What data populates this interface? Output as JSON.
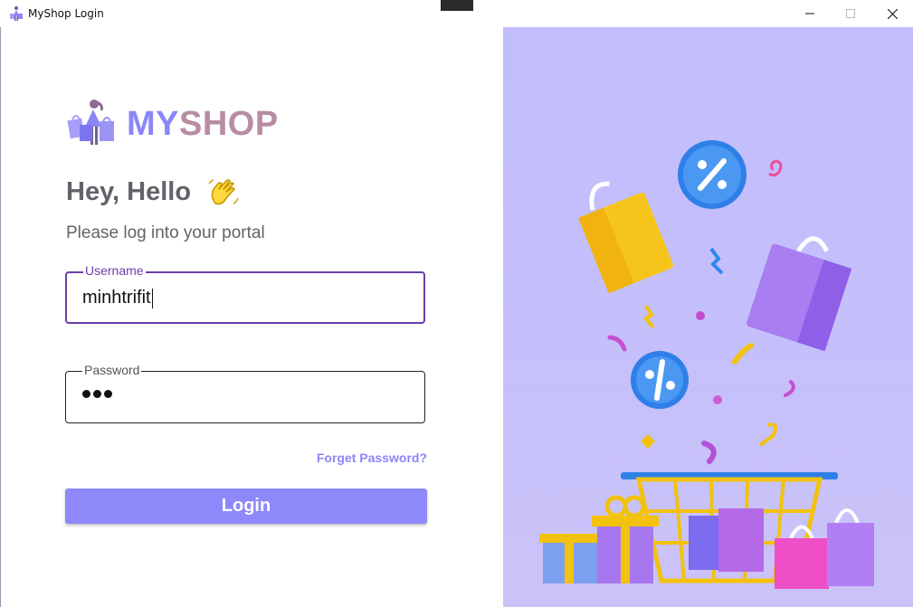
{
  "window": {
    "title": "MyShop Login",
    "minimize_label": "—",
    "maximize_label": "☐",
    "close_label": "✕"
  },
  "brand": {
    "name_part1": "MY",
    "name_part2": "SHOP"
  },
  "greeting": {
    "title": "Hey, Hello",
    "subtitle": "Please log into your portal"
  },
  "form": {
    "username": {
      "label": "Username",
      "value": "minhtrifit"
    },
    "password": {
      "label": "Password",
      "masked_length": 3
    },
    "forget_label": "Forget Password?",
    "login_label": "Login"
  },
  "colors": {
    "accent": "#8b86f8",
    "button": "#8e89fb",
    "focus_border": "#6b3fa8",
    "text": "#616369",
    "illustration_bg": "#c2bdfd"
  },
  "icons": {
    "app": "shopping-girl-icon",
    "wave": "waving-hand-icon",
    "illustration": "shopping-basket-illustration"
  }
}
